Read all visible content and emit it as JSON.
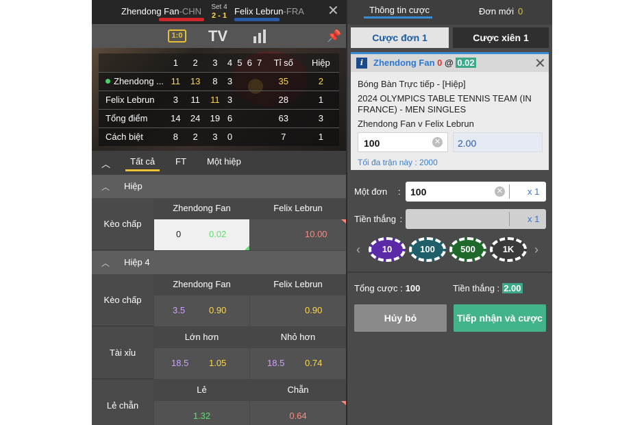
{
  "match": {
    "home": {
      "name": "Zhendong Fan",
      "country": "-CHN",
      "color": "#d0282a"
    },
    "away": {
      "name": "Felix Lebrun",
      "country": "-FRA",
      "color": "#2a5ba8"
    },
    "set_label": "Set 4",
    "set_score": "2 - 1"
  },
  "media": {
    "score_icon": "1:0",
    "tv_label": "TV"
  },
  "scoreboard": {
    "headers": [
      "1",
      "2",
      "3",
      "4",
      "5",
      "6",
      "7",
      "Tỉ số",
      "Hiệp"
    ],
    "rows": [
      {
        "name": "Zhendong ...",
        "cells": [
          "11",
          "13",
          "8",
          "3",
          "",
          "",
          "",
          "35",
          "2"
        ]
      },
      {
        "name": "Felix Lebrun",
        "cells": [
          "3",
          "11",
          "11",
          "3",
          "",
          "",
          "",
          "28",
          "1"
        ]
      },
      {
        "name": "Tổng điểm",
        "cells": [
          "14",
          "24",
          "19",
          "6",
          "",
          "",
          "",
          "63",
          "3"
        ]
      },
      {
        "name": "Cách biệt",
        "cells": [
          "8",
          "2",
          "3",
          "0",
          "",
          "",
          "",
          "7",
          "1"
        ]
      }
    ]
  },
  "filters": {
    "all": "Tất cả",
    "ft": "FT",
    "one_set": "Một hiệp"
  },
  "sections": [
    {
      "title": "Hiệp",
      "markets": [
        {
          "label": "Kèo chấp",
          "col_home": "Zhendong Fan",
          "col_away": "Felix Lebrun",
          "home_hcap": "0",
          "home_odds": "0.02",
          "away_hcap": "",
          "away_odds": "10.00"
        }
      ]
    },
    {
      "title": "Hiệp 4",
      "markets": [
        {
          "label": "Kèo chấp",
          "col_home": "Zhendong Fan",
          "col_away": "Felix Lebrun",
          "home_hcap": "3.5",
          "home_odds": "0.90",
          "away_hcap": "",
          "away_odds": "0.90"
        },
        {
          "label": "Tài xỉu",
          "col_home": "Lớn hơn",
          "col_away": "Nhỏ hơn",
          "home_hcap": "18.5",
          "home_odds": "1.05",
          "away_hcap": "18.5",
          "away_odds": "0.74"
        },
        {
          "label": "Lẻ chẵn",
          "col_home": "Lẻ",
          "col_away": "Chẵn",
          "home_hcap": "",
          "home_odds": "1.32",
          "away_hcap": "",
          "away_odds": "0.64"
        }
      ]
    }
  ],
  "right_panel": {
    "tab_bet_info": "Thông tin cược",
    "tab_new_orders": "Đơn mới",
    "new_orders_count": "0",
    "bet_type_single": "Cược đơn 1",
    "bet_type_parlay": "Cược xiên 1",
    "slip": {
      "team": "Zhendong Fan",
      "hcap": "0",
      "at": "@",
      "price": "0.02",
      "sport_line": "Bóng Bàn Trực tiếp - [Hiệp]",
      "league_line": "2024 OLYMPICS TABLE TENNIS TEAM (IN FRANCE) - MEN SINGLES",
      "match_line": "Zhendong Fan v Felix Lebrun",
      "stake": "100",
      "odds": "2.00",
      "max_note": "Tối đa trận này : 2000"
    },
    "single_label": "Một đơn",
    "single_value": "100",
    "win_label": "Tiền thắng",
    "win_value": "",
    "colon": ":",
    "multiplier": "x 1",
    "chips": [
      {
        "label": "10",
        "color": "#5b2aa6"
      },
      {
        "label": "100",
        "color": "#1f5f6a"
      },
      {
        "label": "500",
        "color": "#1f6a2a"
      },
      {
        "label": "1K",
        "color": "#3a3a3a"
      }
    ],
    "total_label": "Tổng cược :",
    "total_value": "100",
    "win_total_label": "Tiền thắng :",
    "win_total_value": "2.00",
    "cancel_label": "Hủy bỏ",
    "accept_label": "Tiếp nhận và cược"
  }
}
